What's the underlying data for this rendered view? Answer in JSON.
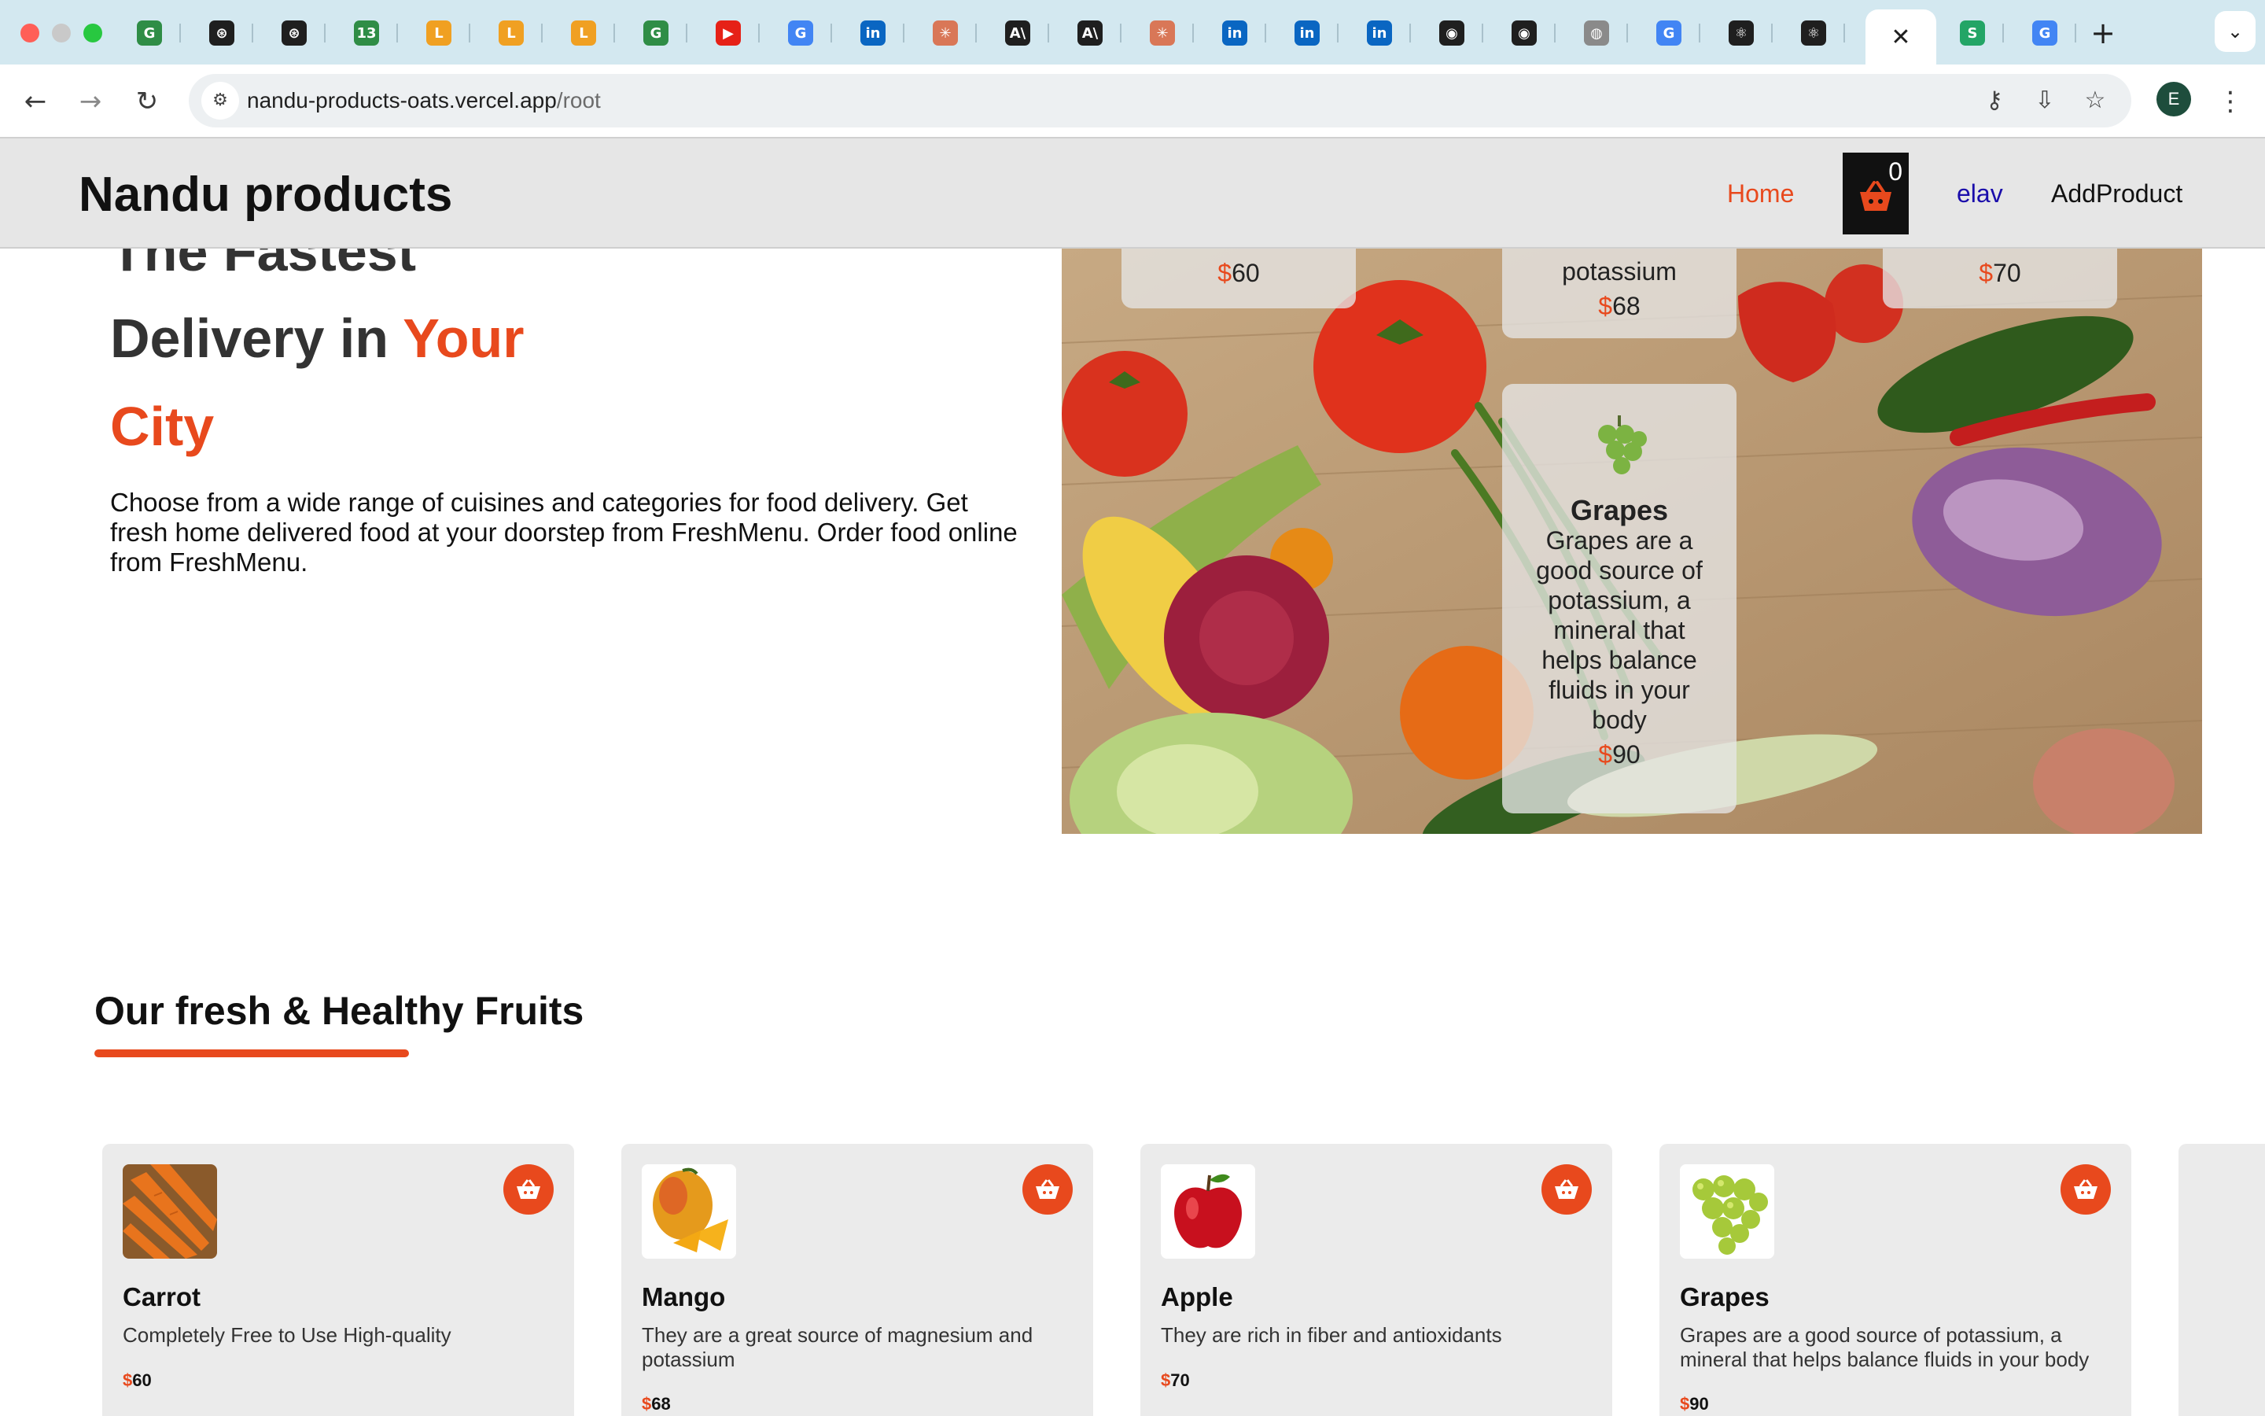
{
  "browser": {
    "active_tab_close": "✕",
    "new_tab_label": "+",
    "tab_search": "⌄",
    "url_host": "nandu-products-oats.vercel.app",
    "url_path": "/root",
    "profile_initial": "E",
    "tabs": [
      {
        "icon": "geeksforgeeks-icon",
        "glyph": "G",
        "color": "#2f8d46"
      },
      {
        "icon": "openai-icon",
        "glyph": "⊛",
        "color": "#1f1f1f"
      },
      {
        "icon": "openai-icon",
        "glyph": "⊛",
        "color": "#1f1f1f"
      },
      {
        "icon": "notification-13-icon",
        "glyph": "13",
        "color": "#2f8d46"
      },
      {
        "icon": "leetcode-icon",
        "glyph": "L",
        "color": "#f0a022"
      },
      {
        "icon": "leetcode-icon",
        "glyph": "L",
        "color": "#f0a022"
      },
      {
        "icon": "leetcode-icon",
        "glyph": "L",
        "color": "#f0a022"
      },
      {
        "icon": "geeksforgeeks-icon",
        "glyph": "G",
        "color": "#2f8d46"
      },
      {
        "icon": "youtube-icon",
        "glyph": "▶",
        "color": "#e62117"
      },
      {
        "icon": "google-icon",
        "glyph": "G",
        "color": "#4285f4"
      },
      {
        "icon": "linkedin-icon",
        "glyph": "in",
        "color": "#0a66c2"
      },
      {
        "icon": "claude-icon",
        "glyph": "✳",
        "color": "#d97757"
      },
      {
        "icon": "anthropic-icon",
        "glyph": "A\\",
        "color": "#1f1f1f"
      },
      {
        "icon": "anthropic-icon",
        "glyph": "A\\",
        "color": "#1f1f1f"
      },
      {
        "icon": "claude-icon",
        "glyph": "✳",
        "color": "#d97757"
      },
      {
        "icon": "linkedin-icon",
        "glyph": "in",
        "color": "#0a66c2"
      },
      {
        "icon": "linkedin-icon",
        "glyph": "in",
        "color": "#0a66c2"
      },
      {
        "icon": "linkedin-icon",
        "glyph": "in",
        "color": "#0a66c2"
      },
      {
        "icon": "github-icon",
        "glyph": "◉",
        "color": "#1f1f1f"
      },
      {
        "icon": "github-icon",
        "glyph": "◉",
        "color": "#1f1f1f"
      },
      {
        "icon": "globe-icon",
        "glyph": "◍",
        "color": "#8a8a8a"
      },
      {
        "icon": "google-icon",
        "glyph": "G",
        "color": "#4285f4"
      },
      {
        "icon": "react-icon",
        "glyph": "⚛",
        "color": "#1f1f1f"
      },
      {
        "icon": "react-icon",
        "glyph": "⚛",
        "color": "#1f1f1f"
      },
      {
        "icon": "sheets-icon",
        "glyph": "S",
        "color": "#23a566"
      },
      {
        "icon": "google-icon",
        "glyph": "G",
        "color": "#4285f4"
      }
    ]
  },
  "header": {
    "brand": "Nandu products",
    "nav_home": "Home",
    "cart_count": "0",
    "nav_user": "elav",
    "nav_add": "AddProduct"
  },
  "hero": {
    "line1": "The Fastest",
    "line2_a": "Delivery in",
    "line2_b": "Your",
    "line3": "City",
    "description": "Choose from a wide range of cuisines and categories for food delivery. Get fresh home delivered food at your doorstep from FreshMenu. Order food online from FreshMenu.",
    "floating_cards": [
      {
        "price_symbol": "$",
        "price": "60"
      },
      {
        "partial_text": "potassium",
        "price_symbol": "$",
        "price": "68"
      },
      {
        "price_symbol": "$",
        "price": "70"
      },
      {
        "name": "Grapes",
        "desc": "Grapes are a good source of potassium, a mineral that helps balance fluids in your body",
        "price_symbol": "$",
        "price": "90"
      }
    ]
  },
  "section": {
    "title": "Our fresh & Healthy Fruits"
  },
  "products": [
    {
      "name": "Carrot",
      "desc": "Completely Free to Use High-quality",
      "symbol": "$",
      "price": "60"
    },
    {
      "name": "Mango",
      "desc": "They are a great source of magnesium and potassium",
      "symbol": "$",
      "price": "68"
    },
    {
      "name": "Apple",
      "desc": "They are rich in fiber and antioxidants",
      "symbol": "$",
      "price": "70"
    },
    {
      "name": "Grapes",
      "desc": "Grapes are a good source of potassium, a mineral that helps balance fluids in your body",
      "symbol": "$",
      "price": "90"
    }
  ],
  "colors": {
    "accent": "#e8491d",
    "header_bg": "#e6e6e6",
    "card_bg": "#ebebeb",
    "tabstrip_bg": "#d3e8f0"
  }
}
